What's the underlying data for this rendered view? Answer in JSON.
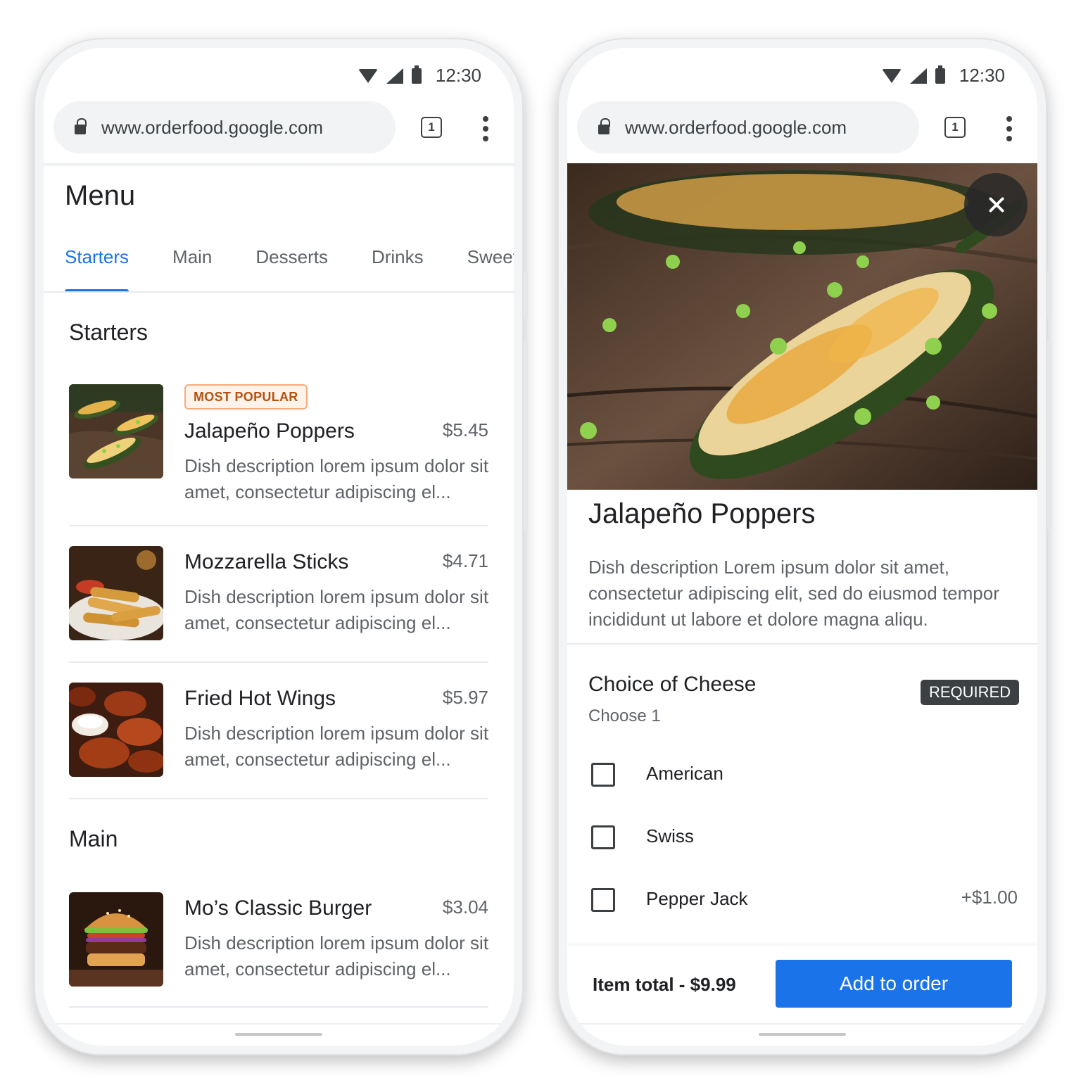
{
  "status": {
    "time": "12:30"
  },
  "browser": {
    "url": "www.orderfood.google.com",
    "tab_count": "1"
  },
  "menu_screen": {
    "title": "Menu",
    "tabs": [
      {
        "label": "Starters"
      },
      {
        "label": "Main"
      },
      {
        "label": "Desserts"
      },
      {
        "label": "Drinks"
      },
      {
        "label": "Sweets"
      }
    ],
    "sections": [
      {
        "title": "Starters",
        "items": [
          {
            "badge": "MOST POPULAR",
            "name": "Jalapeño Poppers",
            "price": "$5.45",
            "desc": "Dish description lorem ipsum dolor sit amet, consectetur adipiscing el..."
          },
          {
            "name": "Mozzarella Sticks",
            "price": "$4.71",
            "desc": "Dish description lorem ipsum dolor sit amet, consectetur adipiscing el..."
          },
          {
            "name": "Fried Hot Wings",
            "price": "$5.97",
            "desc": "Dish description lorem ipsum dolor sit amet, consectetur adipiscing el..."
          }
        ]
      },
      {
        "title": "Main",
        "items": [
          {
            "name": "Mo’s Classic Burger",
            "price": "$3.04",
            "desc": "Dish description lorem ipsum dolor sit amet, consectetur adipiscing el..."
          }
        ]
      }
    ]
  },
  "detail_screen": {
    "title": "Jalapeño Poppers",
    "description": "Dish description Lorem ipsum dolor sit amet, consectetur adipiscing elit, sed do eiusmod tempor incididunt ut labore et dolore magna aliqu.",
    "choice_group": {
      "title": "Choice of Cheese",
      "subtitle": "Choose 1",
      "badge": "REQUIRED",
      "options": [
        {
          "label": "American",
          "price": ""
        },
        {
          "label": "Swiss",
          "price": ""
        },
        {
          "label": "Pepper Jack",
          "price": "+$1.00"
        }
      ]
    },
    "item_total": "Item total - $9.99",
    "add_button": "Add to order"
  },
  "colors": {
    "accent": "#1a73e8",
    "popular_badge": "#b5520f",
    "required_badge": "#3c4043"
  }
}
